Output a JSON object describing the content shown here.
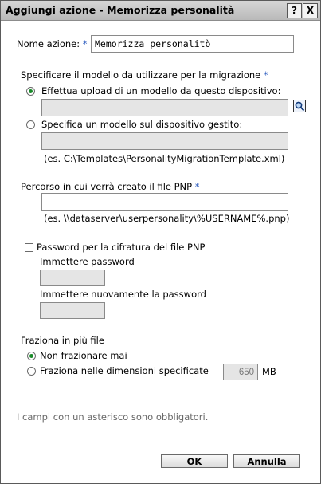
{
  "dialog": {
    "title": "Aggiungi azione - Memorizza personalità",
    "help_label": "?",
    "close_label": "X"
  },
  "form": {
    "action_name_label": "Nome azione:",
    "required_marker": "*",
    "action_name_value": "Memorizza personalitò",
    "model_section_label": "Specificare il modello da utilizzare per la migrazione",
    "upload_option_label": "Effettua upload di un modello da questo dispositivo:",
    "upload_value": "",
    "managed_option_label": "Specifica un modello sul dispositivo gestito:",
    "managed_value": "",
    "managed_example": "(es. C:\\Templates\\PersonalityMigrationTemplate.xml)",
    "pnp_path_label": "Percorso in cui verrà creato il file PNP",
    "pnp_path_value": "",
    "pnp_path_example": "(es. \\\\dataserver\\userpersonality\\%USERNAME%.pnp)",
    "password_checkbox_label": "Password per la cifratura del file PNP",
    "password_label": "Immettere password",
    "password_confirm_label": "Immettere nuovamente la password",
    "split_section_label": "Fraziona in più file",
    "split_none_label": "Non frazionare mai",
    "split_size_label": "Fraziona nelle dimensioni specificate",
    "split_size_value": "650",
    "split_size_unit": "MB",
    "required_note": "I campi con un asterisco sono obbligatori."
  },
  "buttons": {
    "ok_label": "OK",
    "cancel_label": "Annulla"
  },
  "state": {
    "upload_option_selected": true,
    "split_none_selected": true,
    "password_checked": false
  },
  "colors": {
    "required_marker": "#2a5bbf",
    "radio_selected": "#1a8a2a",
    "disabled_field": "#e5e5e5"
  }
}
